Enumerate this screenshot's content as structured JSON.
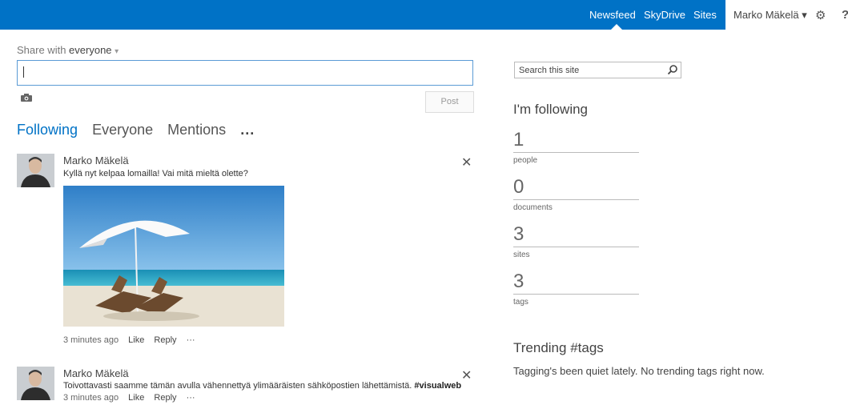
{
  "topbar": {
    "links": [
      "Newsfeed",
      "SkyDrive",
      "Sites"
    ],
    "user_name": "Marko Mäkelä",
    "user_caret": "▾",
    "settings_icon": "gear-icon",
    "help_icon": "help-icon",
    "help_glyph": "?",
    "accent": "#0072c6"
  },
  "share": {
    "prefix": "Share with",
    "audience": "everyone",
    "audience_caret": "▾",
    "post_placeholder": "",
    "post_button": "Post",
    "camera_icon": "camera-icon"
  },
  "tabs": [
    {
      "label": "Following",
      "active": true
    },
    {
      "label": "Everyone",
      "active": false
    },
    {
      "label": "Mentions",
      "active": false
    }
  ],
  "tabs_more": "...",
  "posts": [
    {
      "author": "Marko Mäkelä",
      "text": "Kyllä nyt kelpaa lomailla! Vai mitä mieltä olette?",
      "time": "3 minutes ago",
      "like": "Like",
      "reply": "Reply",
      "more": "···",
      "close": "✕"
    },
    {
      "author": "Marko Mäkelä",
      "text": "Toivottavasti saamme tämän avulla vähennettyä ylimääräisten sähköpostien lähettämistä.",
      "hashtag": "#visualweb",
      "time": "3 minutes ago",
      "like": "Like",
      "reply": "Reply",
      "more": "···",
      "close": "✕"
    }
  ],
  "sidebar": {
    "search_placeholder": "Search this site",
    "following_heading": "I'm following",
    "stats": [
      {
        "value": "1",
        "label": "people"
      },
      {
        "value": "0",
        "label": "documents"
      },
      {
        "value": "3",
        "label": "sites"
      },
      {
        "value": "3",
        "label": "tags"
      }
    ],
    "trending_heading": "Trending #tags",
    "trending_text": "Tagging's been quiet lately. No trending tags right now."
  }
}
